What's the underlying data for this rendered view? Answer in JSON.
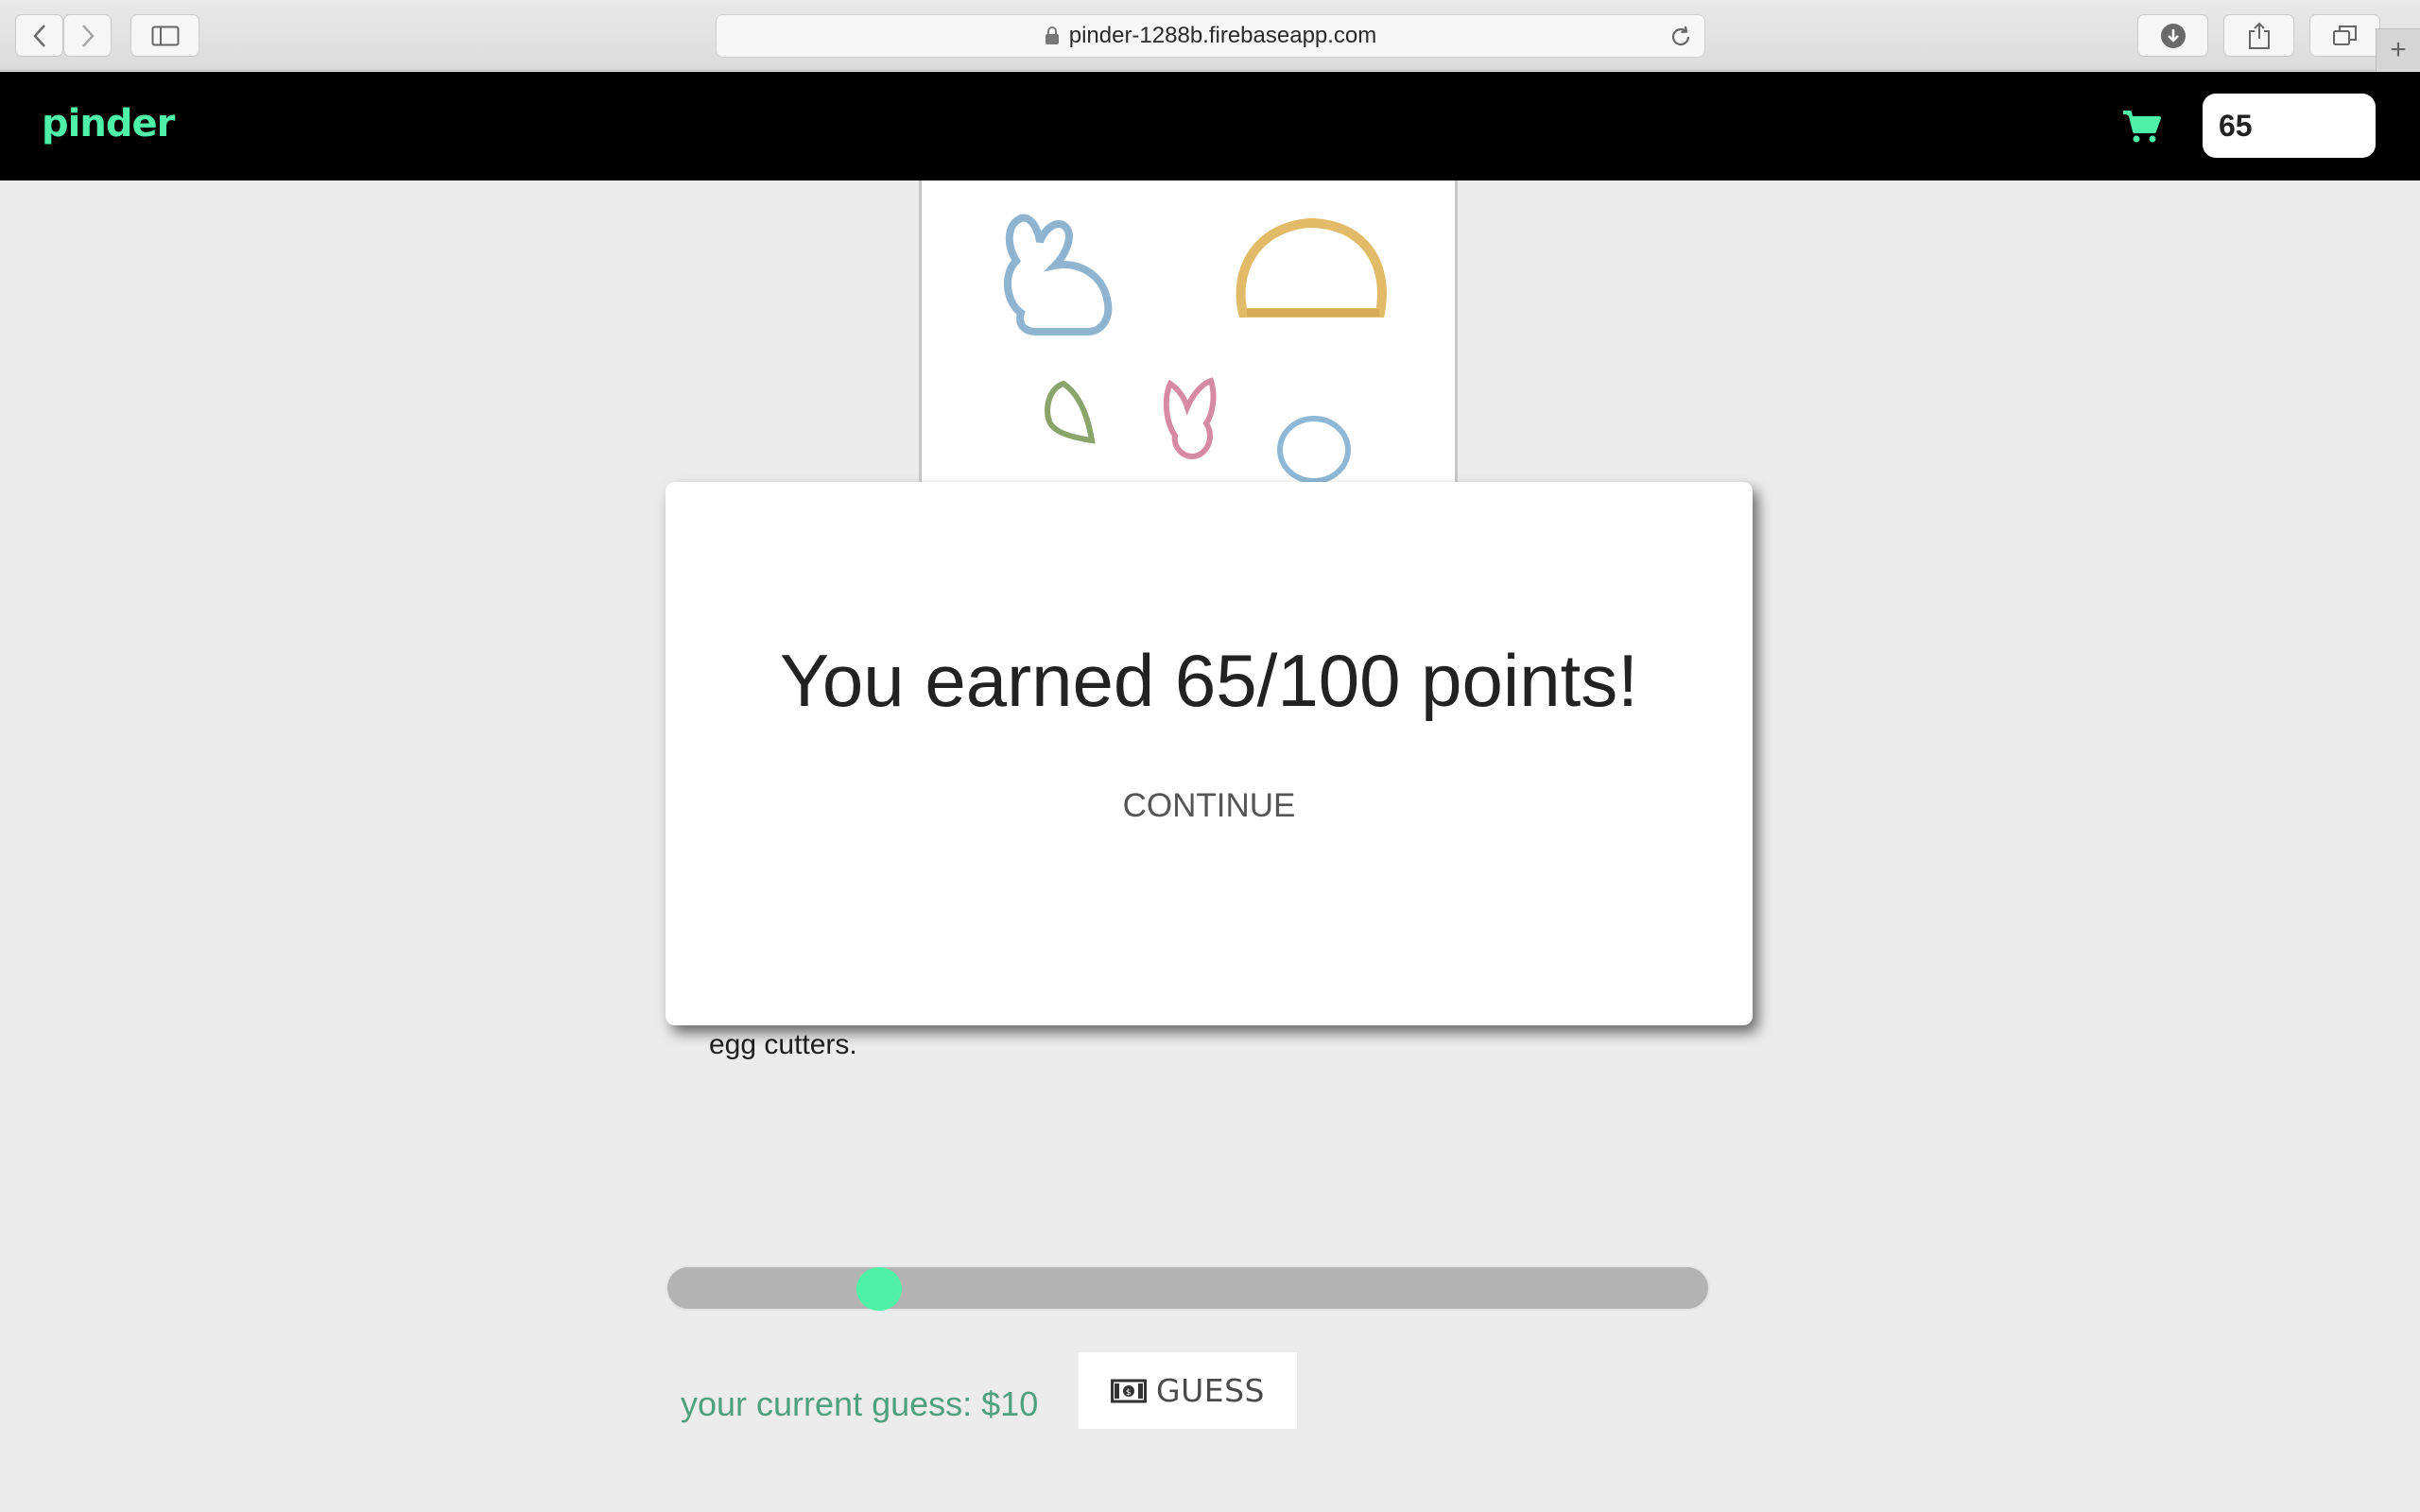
{
  "browser": {
    "url": "pinder-1288b.firebaseapp.com"
  },
  "navbar": {
    "logo": "pinder",
    "points": "65",
    "accent": "#4ff0a8"
  },
  "product": {
    "image_alt": "Easter cookie cutters",
    "description_tail": "egg cutters."
  },
  "slider": {
    "level": 0.19
  },
  "guess": {
    "current_text": "your current guess: $10",
    "button_label": "GUESS"
  },
  "modal": {
    "title": "You earned 65/100 points!",
    "continue_label": "CONTINUE"
  }
}
